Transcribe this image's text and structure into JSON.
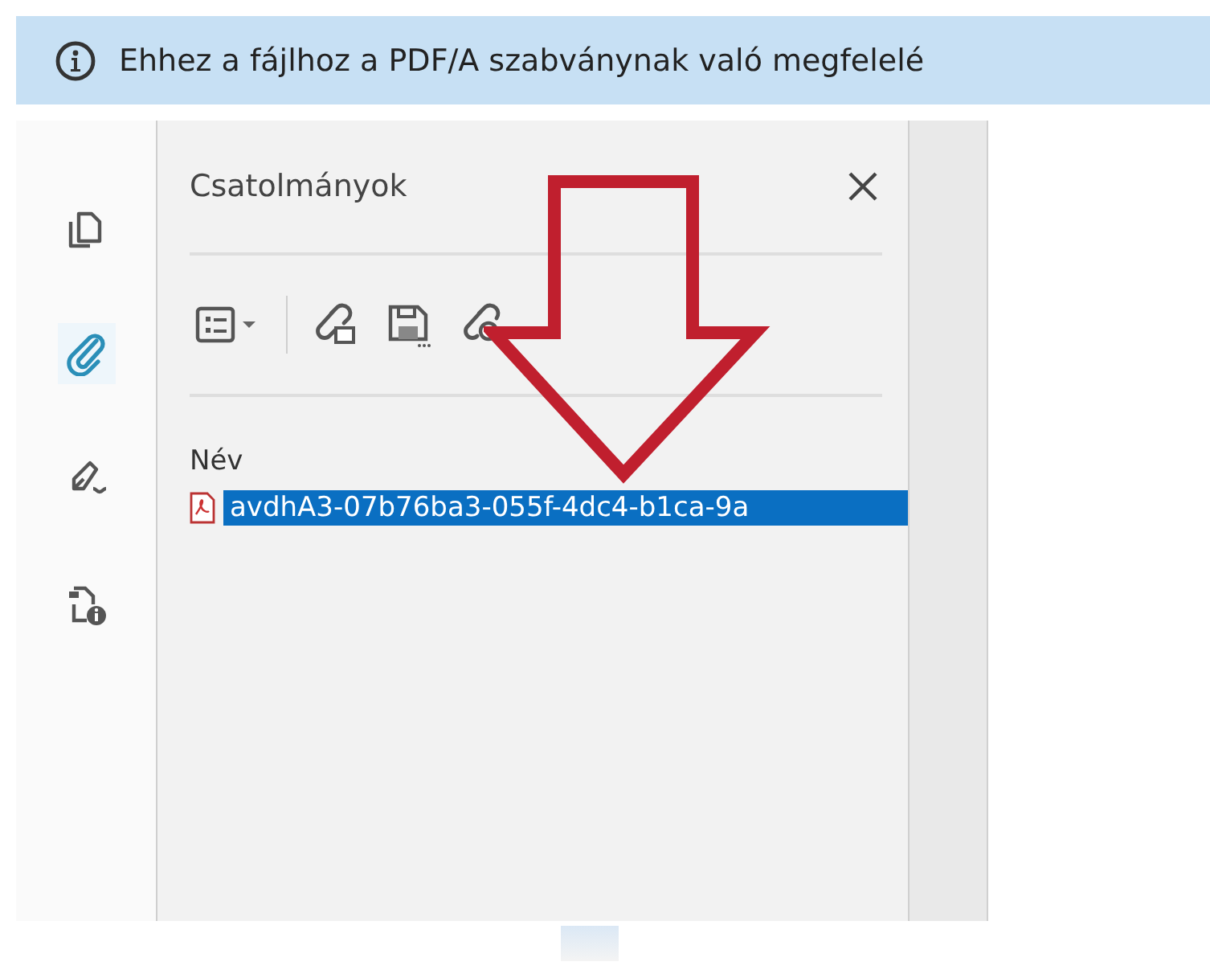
{
  "info_bar": {
    "message": "Ehhez a fájlhoz a PDF/A szabványnak való megfelelé"
  },
  "side_rail": {
    "items": [
      {
        "kind": "pages",
        "selected": false
      },
      {
        "kind": "attachments",
        "selected": true
      },
      {
        "kind": "signature",
        "selected": false
      },
      {
        "kind": "document-info",
        "selected": false
      }
    ]
  },
  "attachments_panel": {
    "title": "Csatolmányok",
    "toolbar": [
      {
        "kind": "view-options"
      },
      {
        "kind": "attach"
      },
      {
        "kind": "save"
      },
      {
        "kind": "search"
      }
    ],
    "column_header": "Név",
    "files": [
      {
        "name": "avdhA3-07b76ba3-055f-4dc4-b1ca-9a",
        "selected": true
      }
    ]
  }
}
